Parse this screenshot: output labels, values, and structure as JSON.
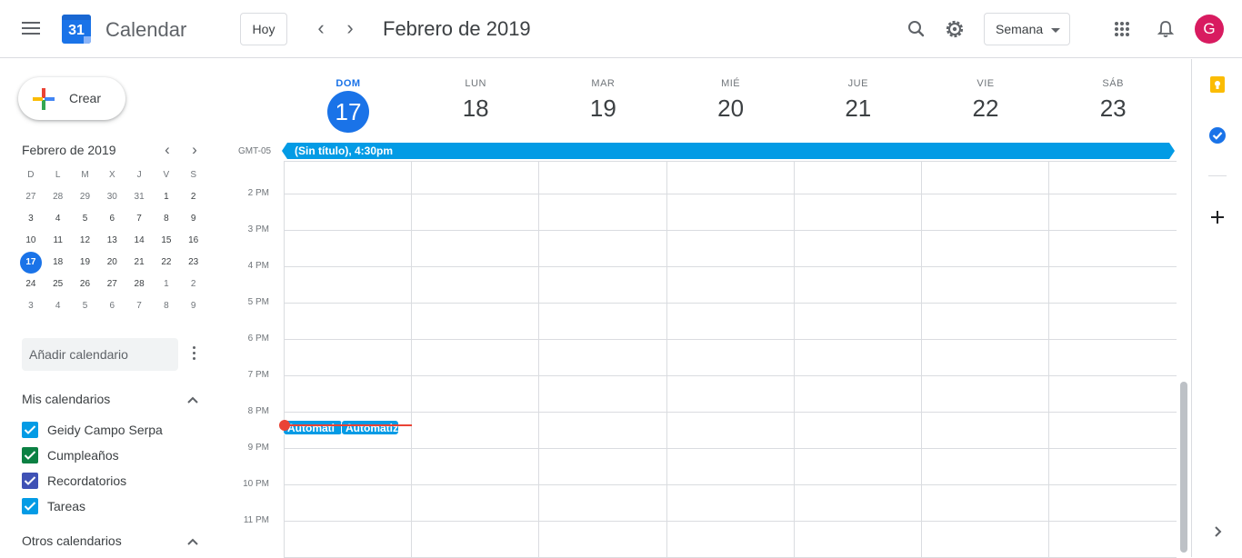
{
  "header": {
    "app_title": "Calendar",
    "logo_day": "31",
    "today_button": "Hoy",
    "period_title": "Febrero de 2019",
    "view_select": "Semana",
    "avatar_initial": "G"
  },
  "sidebar": {
    "create_label": "Crear",
    "mini_calendar": {
      "title": "Febrero de 2019",
      "weekdays": [
        "D",
        "L",
        "M",
        "X",
        "J",
        "V",
        "S"
      ],
      "weeks": [
        [
          "27",
          "28",
          "29",
          "30",
          "31",
          "1",
          "2"
        ],
        [
          "3",
          "4",
          "5",
          "6",
          "7",
          "8",
          "9"
        ],
        [
          "10",
          "11",
          "12",
          "13",
          "14",
          "15",
          "16"
        ],
        [
          "17",
          "18",
          "19",
          "20",
          "21",
          "22",
          "23"
        ],
        [
          "24",
          "25",
          "26",
          "27",
          "28",
          "1",
          "2"
        ],
        [
          "3",
          "4",
          "5",
          "6",
          "7",
          "8",
          "9"
        ]
      ],
      "today": "17"
    },
    "add_calendar_placeholder": "Añadir calendario",
    "my_calendars_title": "Mis calendarios",
    "my_calendars": [
      {
        "name": "Geidy Campo Serpa",
        "color": "#039be5",
        "checked": true
      },
      {
        "name": "Cumpleaños",
        "color": "#0b8043",
        "checked": true
      },
      {
        "name": "Recordatorios",
        "color": "#3f51b5",
        "checked": true
      },
      {
        "name": "Tareas",
        "color": "#039be5",
        "checked": true
      }
    ],
    "other_calendars_title": "Otros calendarios"
  },
  "week": {
    "days": [
      {
        "dow": "DOM",
        "num": "17",
        "today": true
      },
      {
        "dow": "LUN",
        "num": "18"
      },
      {
        "dow": "MAR",
        "num": "19"
      },
      {
        "dow": "MIÉ",
        "num": "20"
      },
      {
        "dow": "JUE",
        "num": "21"
      },
      {
        "dow": "VIE",
        "num": "22"
      },
      {
        "dow": "SÁB",
        "num": "23"
      }
    ],
    "timezone": "GMT-05",
    "all_day_event": "(Sin título), 4:30pm",
    "hours": [
      "2 PM",
      "3 PM",
      "4 PM",
      "5 PM",
      "6 PM",
      "7 PM",
      "8 PM",
      "9 PM",
      "10 PM",
      "11 PM"
    ],
    "events": [
      {
        "title": "Automati",
        "day": "DOM"
      },
      {
        "title": "Automatiz",
        "day": "DOM"
      }
    ]
  },
  "colors": {
    "accent": "#1a73e8",
    "event": "#039be5",
    "now_line": "#ea4335",
    "avatar": "#d81b60"
  },
  "icons": {
    "menu": "hamburger-icon",
    "search": "search-icon",
    "settings": "gear-icon",
    "apps": "apps-grid-icon",
    "notifications": "bell-icon",
    "keep": "keep-icon",
    "tasks": "tasks-icon",
    "add": "plus-icon"
  }
}
